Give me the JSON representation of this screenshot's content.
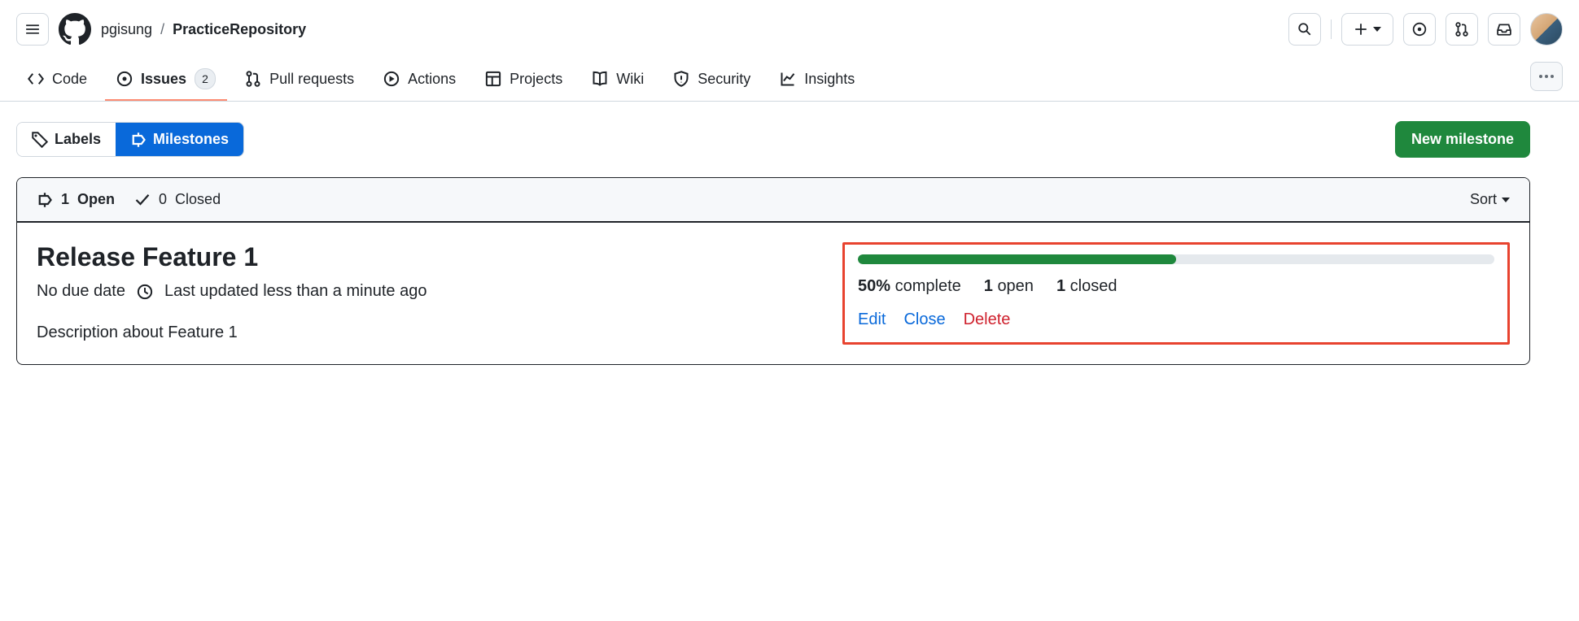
{
  "header": {
    "owner": "pgisung",
    "repo": "PracticeRepository",
    "separator": "/"
  },
  "nav": {
    "code": "Code",
    "issues": "Issues",
    "issues_count": "2",
    "pulls": "Pull requests",
    "actions": "Actions",
    "projects": "Projects",
    "wiki": "Wiki",
    "security": "Security",
    "insights": "Insights"
  },
  "filters": {
    "labels": "Labels",
    "milestones": "Milestones",
    "new_milestone": "New milestone"
  },
  "list_header": {
    "open_count": "1",
    "open_label": "Open",
    "closed_count": "0",
    "closed_label": "Closed",
    "sort": "Sort"
  },
  "milestone": {
    "title": "Release Feature 1",
    "due": "No due date",
    "updated": "Last updated less than a minute ago",
    "description": "Description about Feature 1",
    "progress_percent": 50,
    "complete_pct": "50%",
    "complete_label": "complete",
    "open_count": "1",
    "open_label": "open",
    "closed_count": "1",
    "closed_label": "closed",
    "edit": "Edit",
    "close": "Close",
    "delete": "Delete"
  }
}
